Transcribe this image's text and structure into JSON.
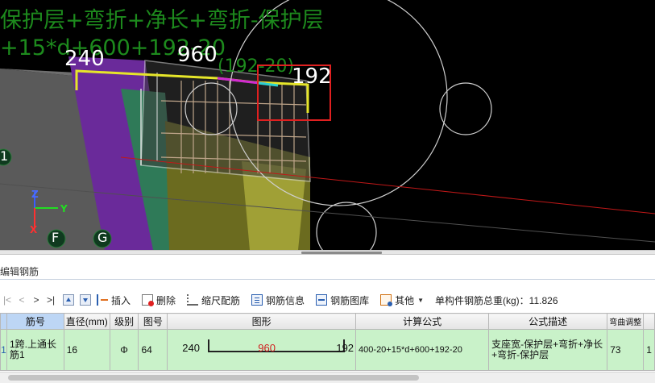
{
  "viewport": {
    "formula_line_1": "保护层+弯折+净长+弯折-保护层",
    "formula_line_2": "+15*d+600+192-20",
    "dim_left": "240",
    "dim_middle": "960",
    "dim_right_green": "(192-20)",
    "dim_right": "192",
    "axis_1": "1",
    "axis_f": "F",
    "axis_g": "G",
    "axis_z": "Z",
    "axis_y": "Y",
    "axis_x": "X"
  },
  "panel": {
    "title": "编辑钢筋"
  },
  "toolbar": {
    "first": "|<",
    "prev": "<",
    "next": ">",
    "last": ">|",
    "insert": "插入",
    "delete": "删除",
    "scale": "缩尺配筋",
    "info": "钢筋信息",
    "library": "钢筋图库",
    "other": "其他",
    "weight_label": "单构件钢筋总重(kg)：11.826"
  },
  "table": {
    "headers": {
      "bar_no": "筋号",
      "diameter": "直径(mm)",
      "grade": "级别",
      "figure_no": "图号",
      "shape": "图形",
      "formula": "计算公式",
      "desc": "公式描述",
      "bend": "弯曲调整"
    },
    "row": {
      "row_num": "1",
      "bar_no": "1跨.上通长筋1",
      "diameter": "16",
      "grade": "Φ",
      "figure_no": "64",
      "shape_left": "240",
      "shape_mid": "960",
      "shape_right": "192",
      "formula": "400-20+15*d+600+192-20",
      "desc": "支座宽-保护层+弯折+净长+弯折-保护层",
      "bend": "73",
      "extra": "1"
    }
  },
  "colors": {
    "viewport_bg": "#000000",
    "label_green": "#1d8a1d",
    "row_green": "#c9f2c9",
    "highlight_red": "#e02020",
    "header_blue": "#bdd6f5"
  }
}
